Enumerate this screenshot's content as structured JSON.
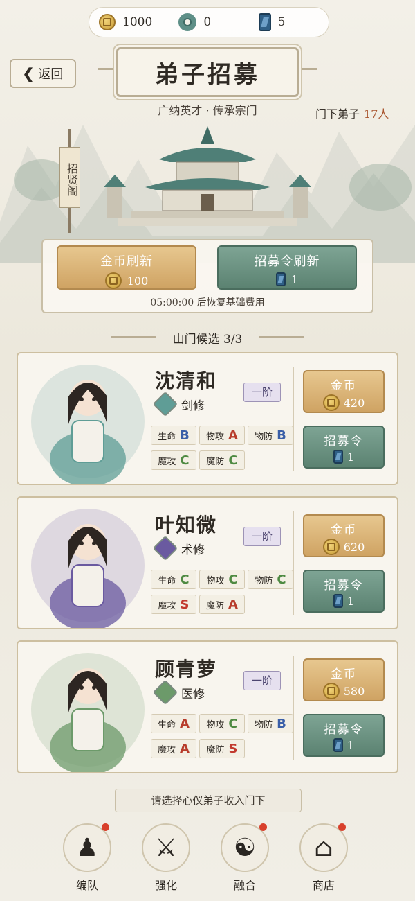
{
  "currency": [
    {
      "icon": "coin-icon",
      "value": "1000"
    },
    {
      "icon": "jade-icon",
      "value": "0"
    },
    {
      "icon": "token-icon",
      "value": "5"
    }
  ],
  "header": {
    "back_label": "返回",
    "title": "弟子招募",
    "subtitle": "广纳英才 · 传承宗门",
    "disciples_label": "门下弟子",
    "disciples_count": "17人"
  },
  "banner_text": "招贤阁",
  "refresh": {
    "gold_label": "金币刷新",
    "gold_cost": "100",
    "token_label": "招募令刷新",
    "token_cost": "1",
    "timer_text": "05:00:00 后恢复基础费用"
  },
  "section_title": "山门候选  3/3",
  "stat_labels": {
    "hp": "生命",
    "patk": "物攻",
    "pdef": "物防",
    "matk": "魔攻",
    "mdef": "魔防"
  },
  "buttons": {
    "coin_label": "金币",
    "token_label": "招募令"
  },
  "heroes": [
    {
      "name": "沈清和",
      "rank": "一阶",
      "class": "剑修",
      "class_icon": "sword-icon",
      "accent": "#5f9d96",
      "stats": {
        "hp": "B",
        "patk": "A",
        "pdef": "B",
        "matk": "C",
        "mdef": "C"
      },
      "coin_cost": "420",
      "token_cost": "1"
    },
    {
      "name": "叶知微",
      "rank": "一阶",
      "class": "术修",
      "class_icon": "spell-icon",
      "accent": "#6a5aa0",
      "stats": {
        "hp": "C",
        "patk": "C",
        "pdef": "C",
        "matk": "S",
        "mdef": "A"
      },
      "coin_cost": "620",
      "token_cost": "1"
    },
    {
      "name": "顾青萝",
      "rank": "一阶",
      "class": "医修",
      "class_icon": "herb-icon",
      "accent": "#6c9a6a",
      "stats": {
        "hp": "A",
        "patk": "C",
        "pdef": "B",
        "matk": "A",
        "mdef": "S"
      },
      "coin_cost": "580",
      "token_cost": "1"
    }
  ],
  "hint": "请选择心仪弟子收入门下",
  "nav": [
    {
      "label": "编队",
      "icon": "team-icon",
      "badge": true
    },
    {
      "label": "强化",
      "icon": "sword-icon",
      "badge": false
    },
    {
      "label": "融合",
      "icon": "yinyang-icon",
      "badge": true
    },
    {
      "label": "商店",
      "icon": "shop-icon",
      "badge": true
    }
  ]
}
